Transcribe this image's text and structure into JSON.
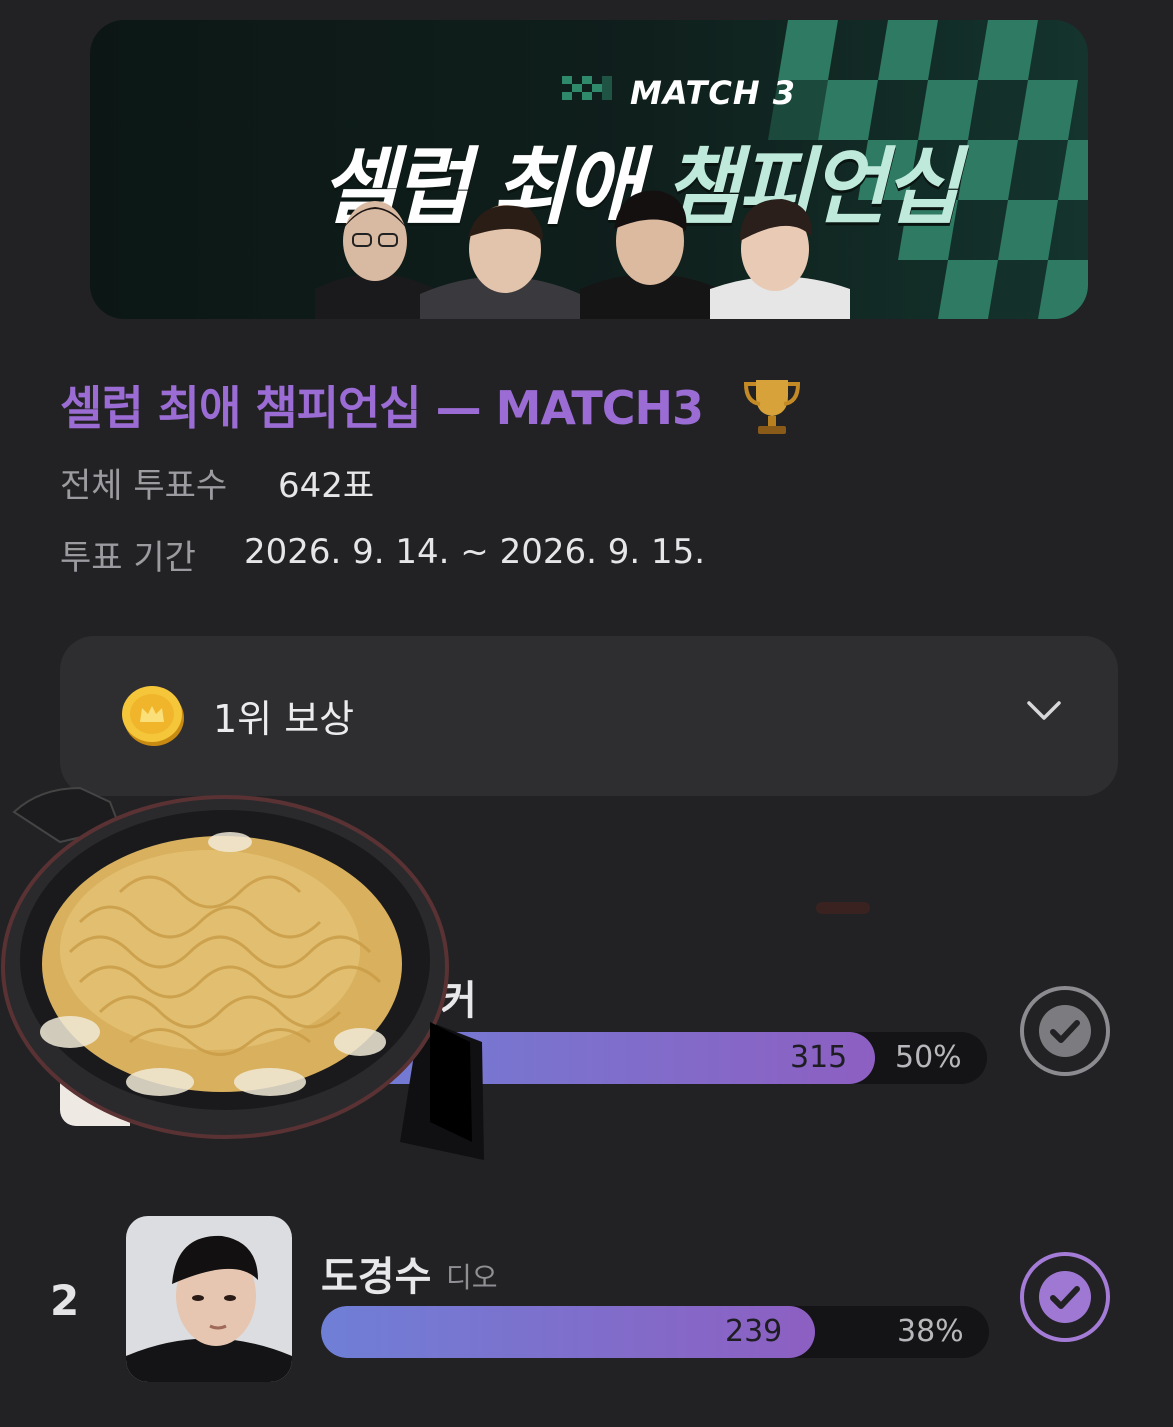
{
  "banner": {
    "match_label": "MATCH 3",
    "title_main": "셀럽 최애 ",
    "title_accent": "챔피언십",
    "accent_color": "#bfeadb",
    "checker_color": "#2e7a62"
  },
  "event": {
    "title": "셀럽 최애 챔피언십 — MATCH3",
    "title_color": "#9a6cd4",
    "total_votes_label": "전체 투표수",
    "total_votes_value": "642표",
    "period_label": "투표 기간",
    "period_value": "2026. 9. 14. ~ 2026. 9. 15."
  },
  "reward": {
    "label": "1위 보상",
    "icon": "coin-crown-icon",
    "chevron": "chevron-down-icon"
  },
  "candidates": [
    {
      "rank": "",
      "name_partial": "커",
      "votes": "315",
      "percent": "50%",
      "fill_fraction": 0.5
    },
    {
      "rank": "2",
      "name": "도경수",
      "alias": "디오",
      "votes": "239",
      "percent": "38%",
      "fill_fraction": 0.38
    }
  ],
  "overlay": {
    "icon": "ramen-pot-sticker"
  }
}
